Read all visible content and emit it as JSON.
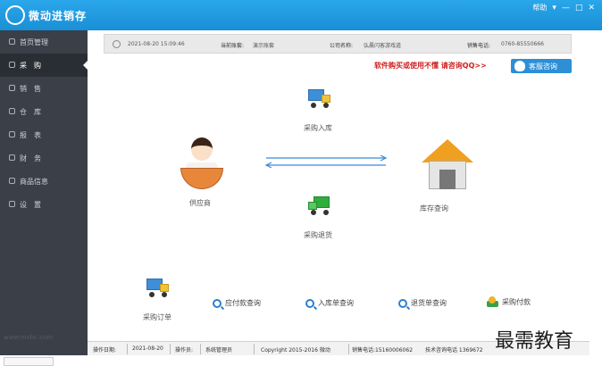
{
  "window": {
    "title": "微动进销存",
    "help": "帮助",
    "minimize_glyph": "—",
    "maximize_glyph": "□",
    "close_glyph": "✕",
    "menu_glyph": "▾"
  },
  "sidebar": {
    "items": [
      {
        "label": "首页管理",
        "icon": "home-icon"
      },
      {
        "label": "采　购",
        "icon": "cart-icon",
        "active": true
      },
      {
        "label": "销　售",
        "icon": "sales-icon"
      },
      {
        "label": "仓　库",
        "icon": "warehouse-icon"
      },
      {
        "label": "报　表",
        "icon": "report-icon"
      },
      {
        "label": "财　务",
        "icon": "finance-icon"
      },
      {
        "label": "商品信息",
        "icon": "goods-icon"
      },
      {
        "label": "设　置",
        "icon": "settings-icon"
      }
    ],
    "watermark": "www.mxbc.com"
  },
  "infobar": {
    "datetime": "2021-08-20 15:09:46",
    "account_label": "当前账套:",
    "account_value": "演示账套",
    "company_label": "公司名称:",
    "company_value": "弘晨闪客游戏道",
    "phone_label": "销售电话:",
    "phone_value": "0760-85550666"
  },
  "promo": {
    "text": "软件购买或使用不懂 请咨询QQ>>",
    "button_label": "客服咨询"
  },
  "diagram": {
    "purchase_in": "采购入库",
    "supplier": "供应商",
    "inventory": "库存查询",
    "purchase_return": "采购退货"
  },
  "actions": {
    "purchase_order": "采购订单",
    "payable_query": "应付款查询",
    "inbound_query": "入库单查询",
    "return_query": "退货单查询",
    "purchase_payment": "采购付款"
  },
  "statusbar": {
    "date_label": "操作日期:",
    "date_value": "2021-08-20",
    "operator_label": "操作员:",
    "operator_value": "系统管理员",
    "copyright": "Copyright  2015-2016 微动",
    "sales_phone": "销售电话:15160006062",
    "tech_phone": "技术咨询电话 1369672"
  },
  "brand_mark": "最需教育",
  "colors": {
    "titlebar": "#1a8fd6",
    "sidebar": "#3a3f48",
    "promo_red": "#d01f1f",
    "accent_blue": "#2d8fd6"
  }
}
